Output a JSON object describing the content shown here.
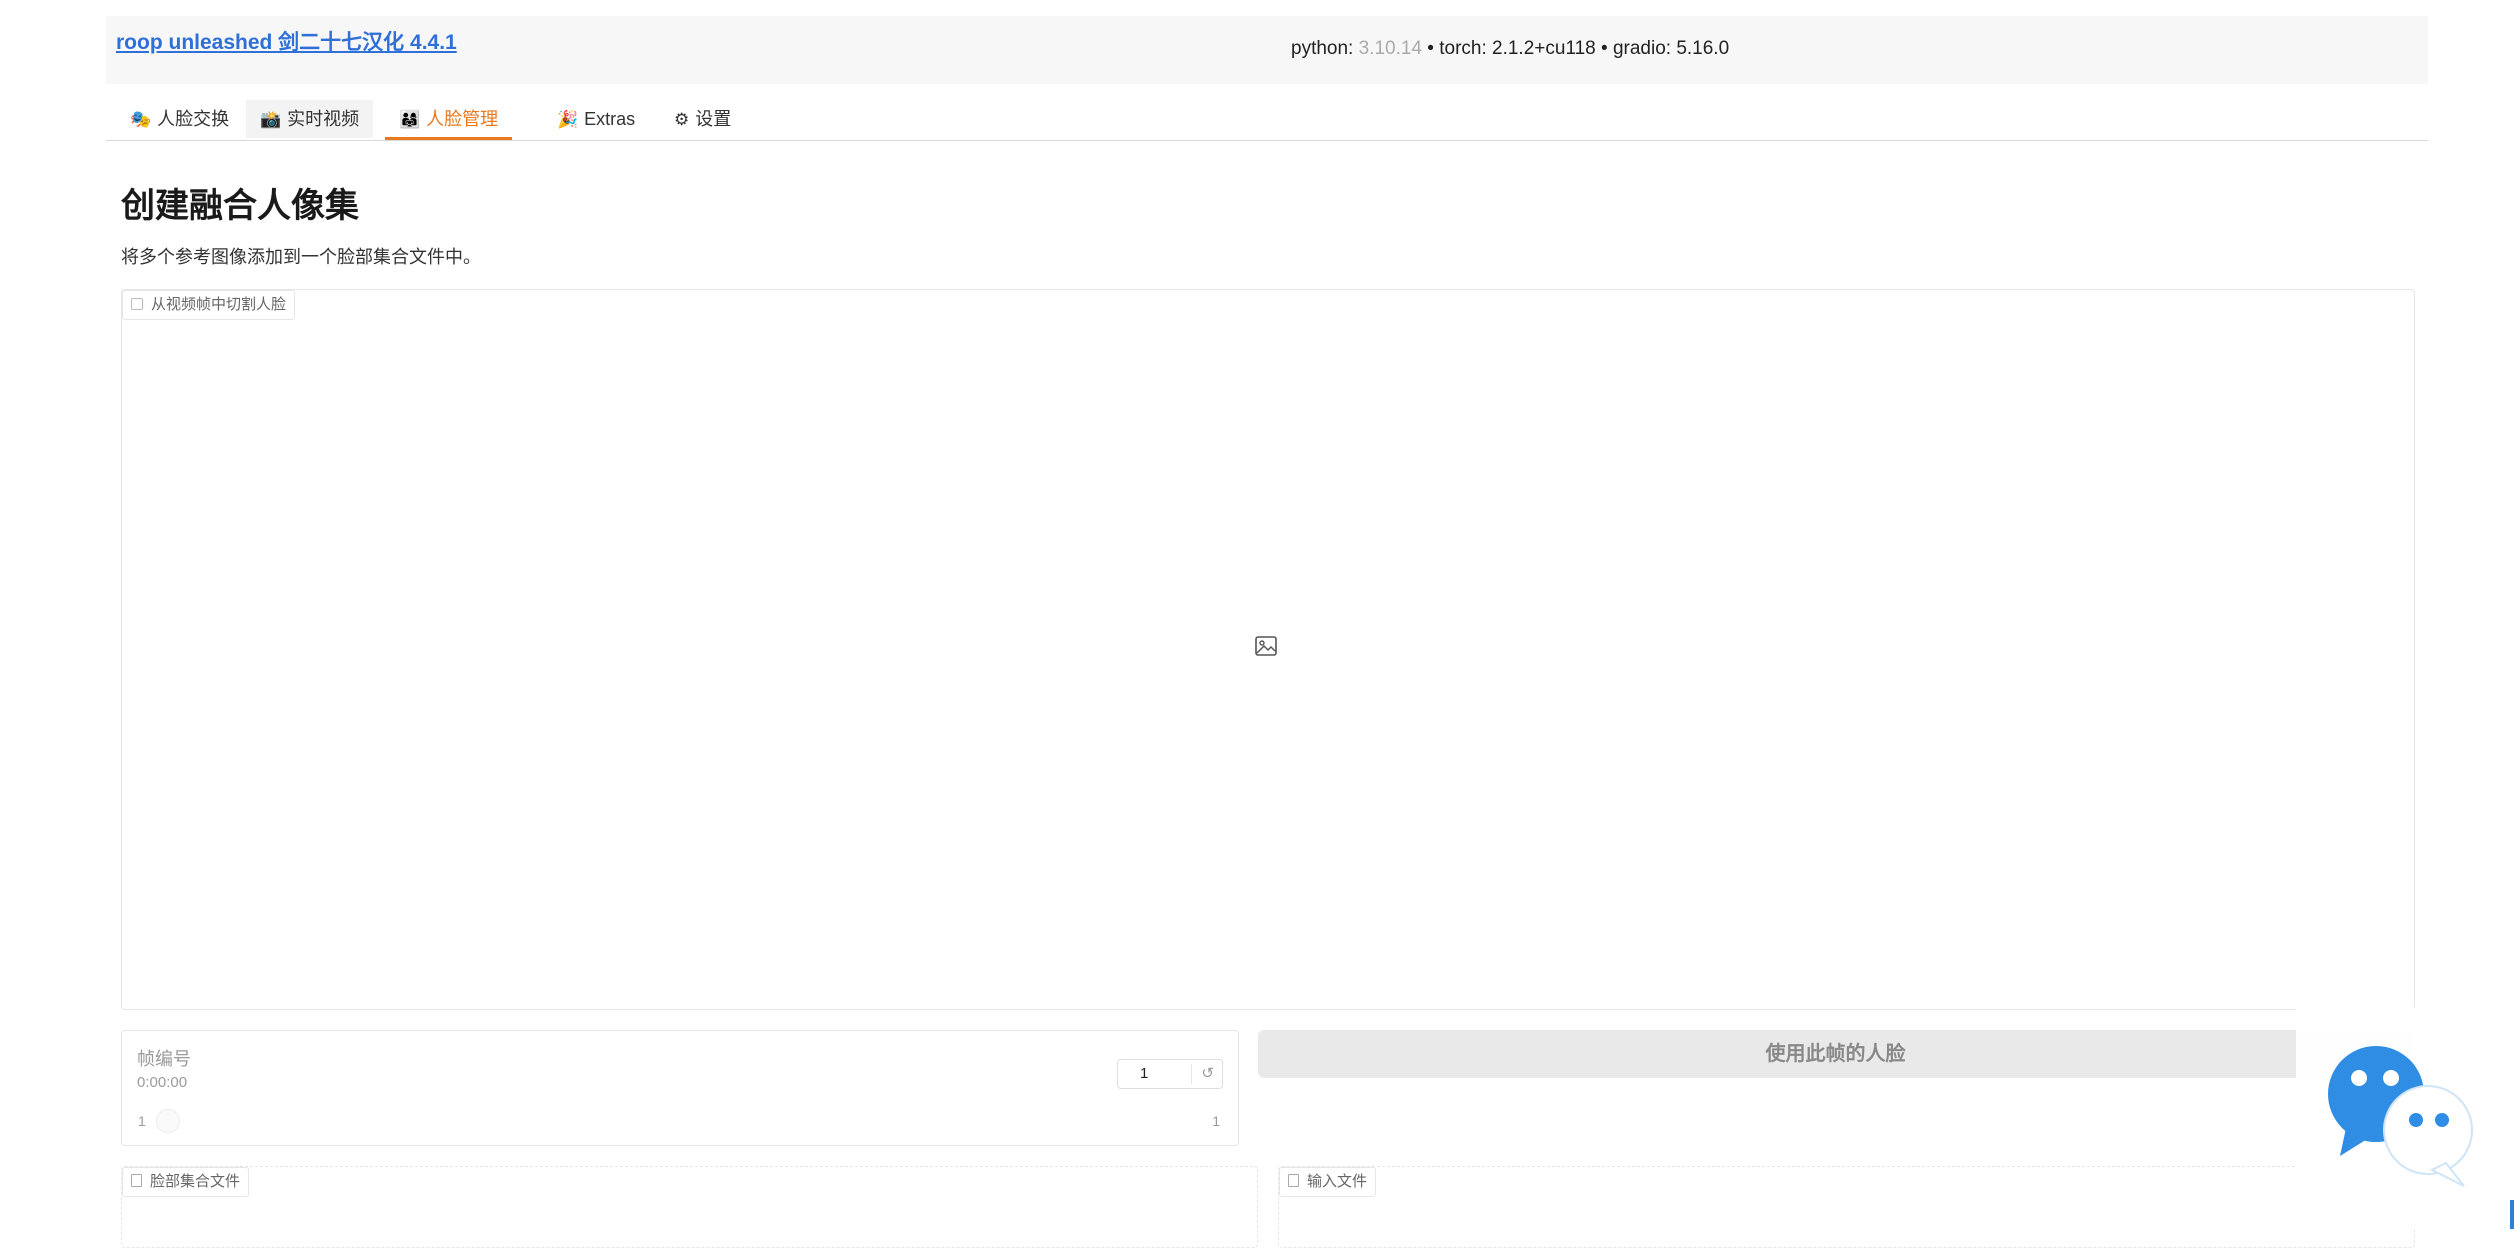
{
  "header": {
    "title": "roop unleashed 剑二十七汉化 4.4.1",
    "versions": {
      "python_label": "python: ",
      "python_version": "3.10.14",
      "torch": " • torch: 2.1.2+cu118",
      "gradio": " • gradio: 5.16.0"
    }
  },
  "tabs": [
    {
      "icon": "🎭",
      "label": "人脸交换"
    },
    {
      "icon": "📸",
      "label": "实时视频"
    },
    {
      "icon": "👨‍👩‍👧",
      "label": "人脸管理",
      "active": true
    },
    {
      "icon": "🎉",
      "label": "Extras"
    },
    {
      "icon": "⚙",
      "label": "设置"
    }
  ],
  "main": {
    "title": "创建融合人像集",
    "description": "将多个参考图像添加到一个脸部集合文件中。",
    "video_label": "从视频帧中切割人脸",
    "frame": {
      "label": "帧编号",
      "time": "0:00:00",
      "value": "1",
      "slider_min": "1",
      "slider_max": "1"
    },
    "use_frame_button": "使用此帧的人脸",
    "faceset_file_label": "脸部集合文件",
    "input_files_label": "输入文件"
  },
  "colors": {
    "accent": "#e8791e",
    "link": "#2e6fd8",
    "chat_blue": "#2f8de4"
  }
}
